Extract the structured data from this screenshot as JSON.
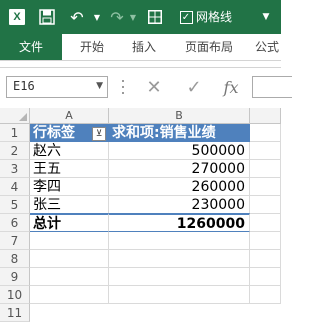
{
  "app": {
    "logo_letter": "X"
  },
  "toolbar": {
    "gridlines_label": "网格线",
    "gridlines_checked": "✓"
  },
  "tabs": [
    {
      "label": "文件"
    },
    {
      "label": "开始"
    },
    {
      "label": "插入"
    },
    {
      "label": "页面布局"
    },
    {
      "label": "公式"
    }
  ],
  "formula_bar": {
    "name_box": "E16",
    "fx": "fx",
    "cancel": "✕",
    "enter": "✓"
  },
  "sheet": {
    "columns": [
      "A",
      "B"
    ],
    "rows": [
      "1",
      "2",
      "3",
      "4",
      "5",
      "6",
      "7",
      "8",
      "9",
      "10",
      "11"
    ],
    "pivot": {
      "header_row": {
        "label": "行标签",
        "value": "求和项:销售业绩"
      },
      "data": [
        {
          "label": "赵六",
          "value": "500000"
        },
        {
          "label": "王五",
          "value": "270000"
        },
        {
          "label": "李四",
          "value": "260000"
        },
        {
          "label": "张三",
          "value": "230000"
        }
      ],
      "total": {
        "label": "总计",
        "value": "1260000"
      }
    }
  },
  "colors": {
    "excel_green": "#217346",
    "pivot_header": "#4f81bd"
  }
}
